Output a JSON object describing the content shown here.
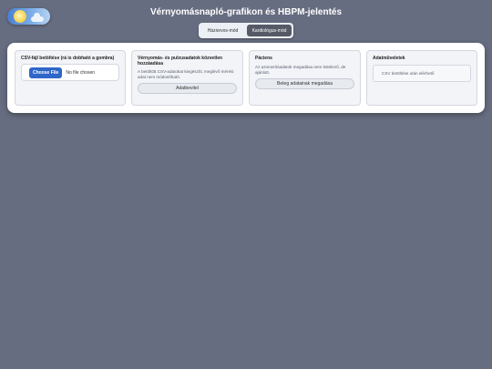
{
  "header": {
    "title": "Vérnyomásnapló-grafikon és HBPM-jelentés",
    "logo_icon": "sun-cloud-icon"
  },
  "mode_switch": {
    "options": [
      "Háziorvos-mód",
      "Kardiológus-mód"
    ],
    "selected": "Kardiológus-mód"
  },
  "cards": {
    "csv": {
      "title": "CSV-fájl betöltése (rá is dobható a gombra)",
      "choose_label": "Choose File",
      "file_status": "No file chosen"
    },
    "manual": {
      "title": "Vérnyomás- és pulzusadatok közvetlen hozzáadása",
      "desc": "A betöltött CSV-adatokat kiegészíti; meglévő mérési adat nem módosítható.",
      "button_label": "Adatbevitel"
    },
    "patient": {
      "title": "Páciens",
      "desc": "Az azonosítóadatok megadása nem kötelező, de ajánlott.",
      "button_label": "Beteg adatainak megadása"
    },
    "data_ops": {
      "title": "Adatműveletek",
      "info": "CSV betöltése után elérhető"
    }
  },
  "colors": {
    "background": "#676d80",
    "accent": "#2e66c9",
    "active_tab": "#555a66"
  }
}
